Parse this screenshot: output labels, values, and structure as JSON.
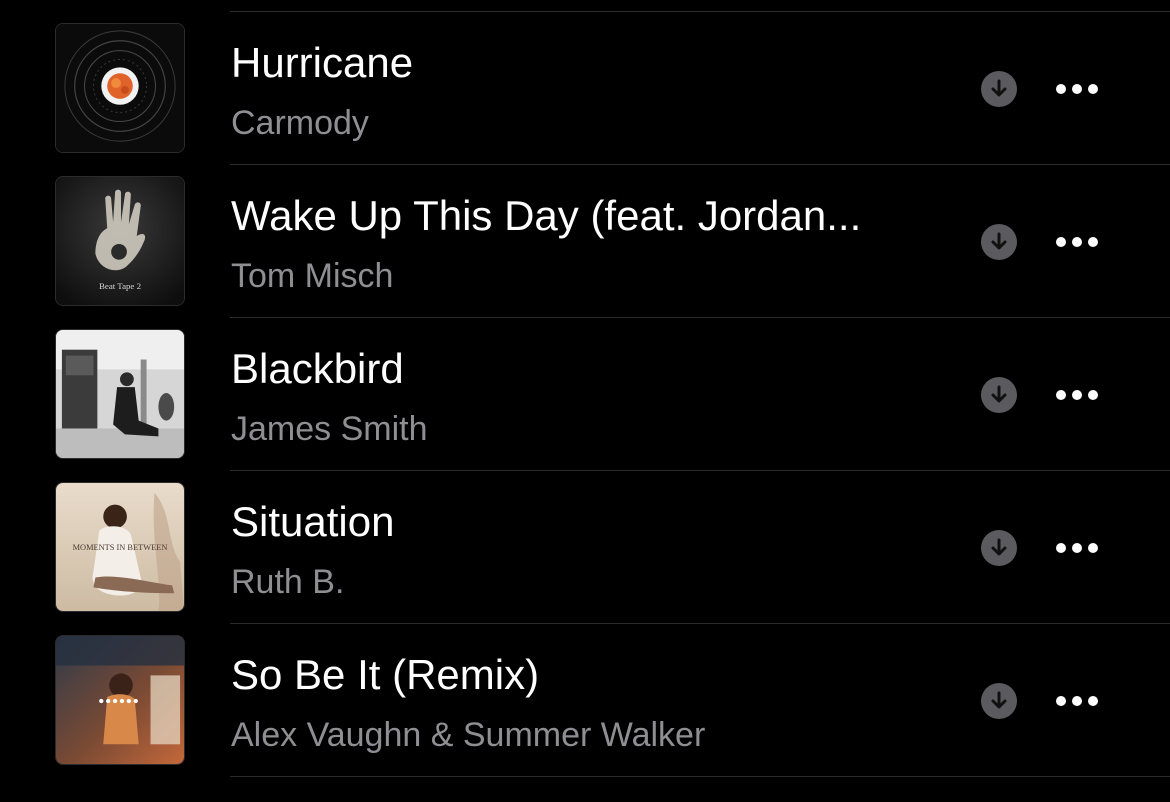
{
  "songs": [
    {
      "title": "Hurricane",
      "artist": "Carmody",
      "artwork": "album-art-hurricane",
      "artwork_text": ""
    },
    {
      "title": "Wake Up This Day (feat. Jordan...",
      "artist": "Tom Misch",
      "artwork": "album-art-beat-tape-2",
      "artwork_text": "Beat Tape 2"
    },
    {
      "title": "Blackbird",
      "artist": "James Smith",
      "artwork": "album-art-blackbird",
      "artwork_text": ""
    },
    {
      "title": "Situation",
      "artist": "Ruth B.",
      "artwork": "album-art-moments-in-between",
      "artwork_text": "MOMENTS IN BETWEEN"
    },
    {
      "title": "So Be It (Remix)",
      "artist": "Alex Vaughn & Summer Walker",
      "artwork": "album-art-so-be-it",
      "artwork_text": ""
    }
  ],
  "icons": {
    "download": "download-icon",
    "more": "more-options-icon"
  },
  "colors": {
    "background": "#000000",
    "title": "#ffffff",
    "artist": "#8e8e93",
    "download_circle": "#5b5b5f",
    "divider": "#2a2a2c"
  }
}
